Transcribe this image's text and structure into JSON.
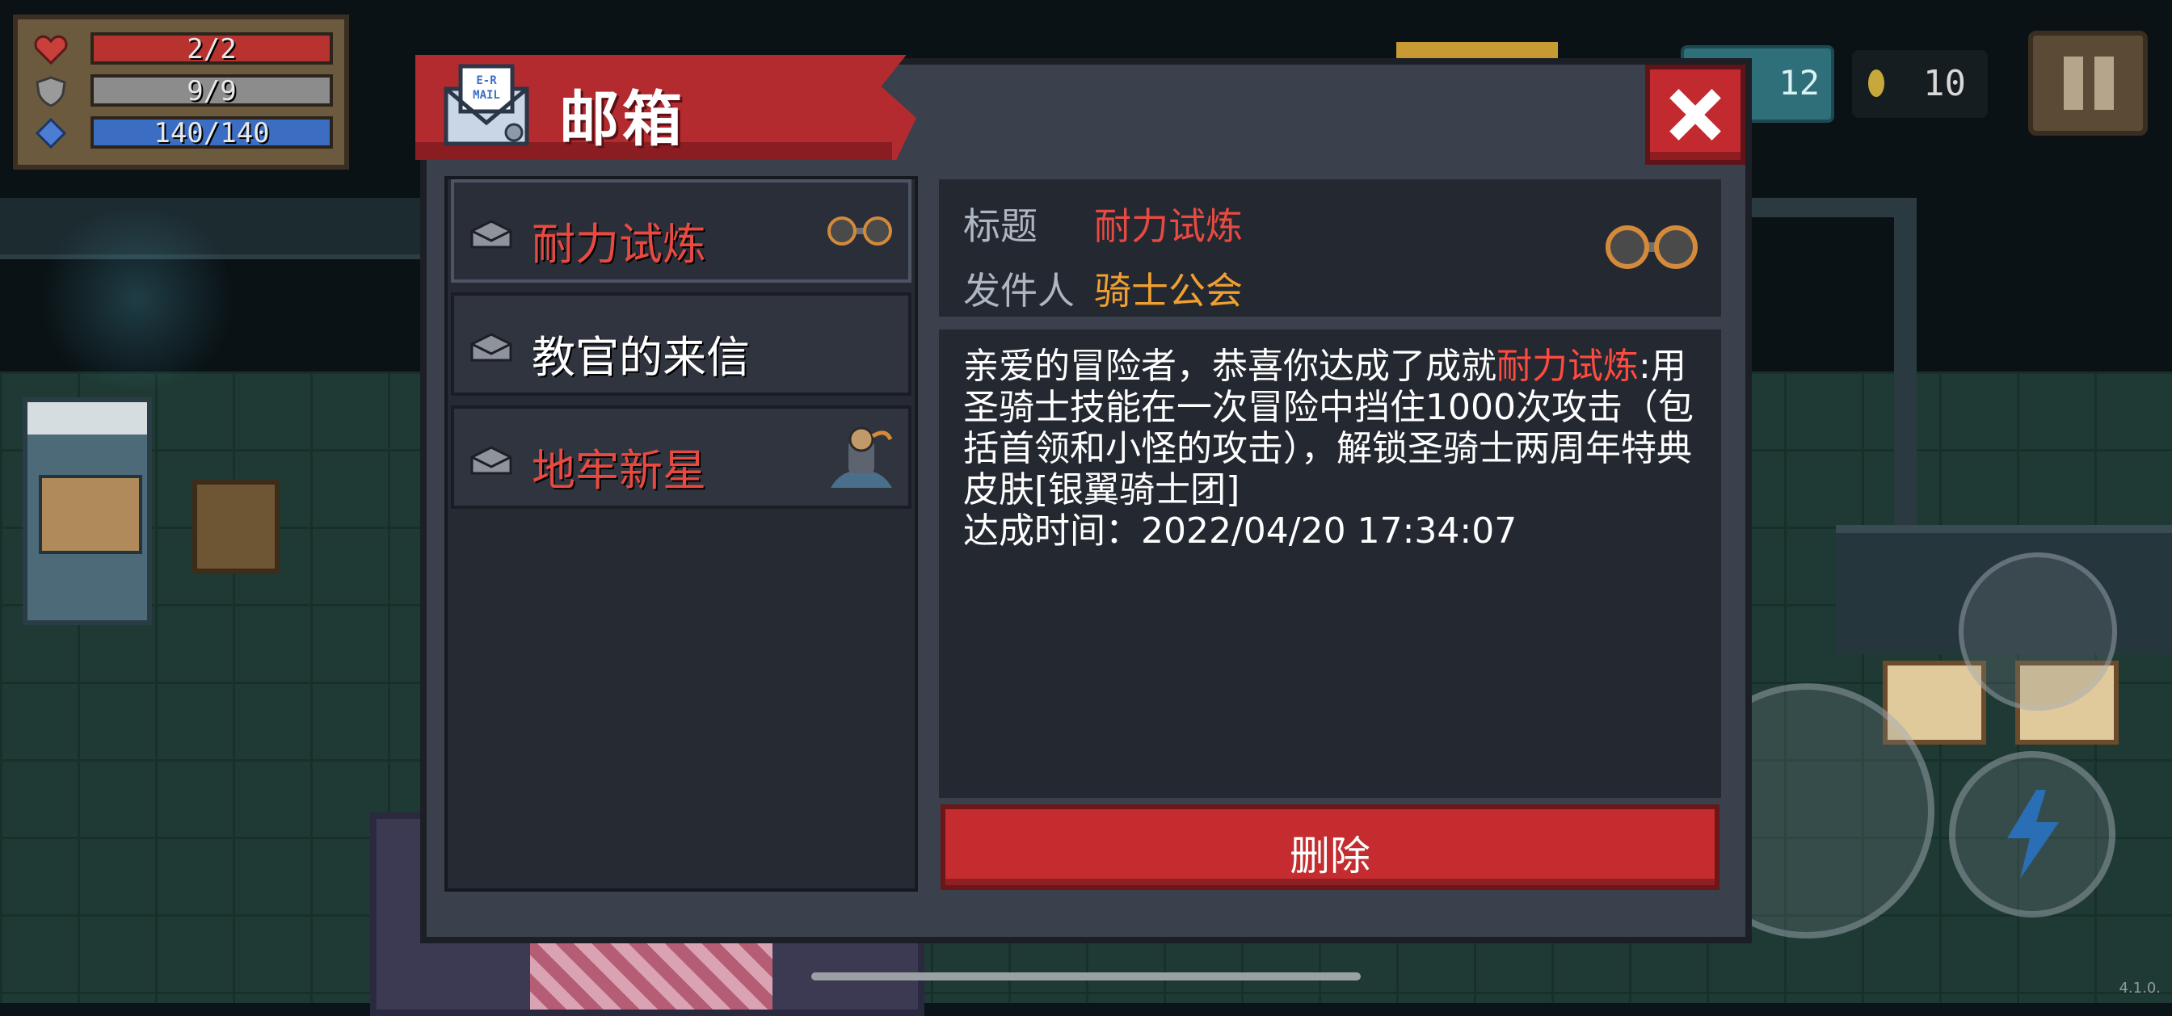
{
  "hud": {
    "health": {
      "text": "2/2",
      "fraction": 1.0,
      "color": "#b8322f"
    },
    "armor": {
      "text": "9/9",
      "fraction": 1.0,
      "color": "#8c8c8c"
    },
    "energy": {
      "text": "140/140",
      "fraction": 1.0,
      "color": "#3b6ec2"
    },
    "gems": "12",
    "coins": "10",
    "version": "4.1.0."
  },
  "mailbox": {
    "title": "邮箱",
    "list": [
      {
        "label": "耐力试炼",
        "style": "red",
        "attachment": "dumbbell-icon",
        "selected": true
      },
      {
        "label": "教官的来信",
        "style": "white",
        "attachment": null,
        "selected": false
      },
      {
        "label": "地牢新星",
        "style": "red",
        "attachment": "character-icon",
        "selected": false
      }
    ],
    "detail": {
      "title_key": "标题",
      "title_value": "耐力试炼",
      "sender_key": "发件人",
      "sender_value": "骑士公会",
      "body_prefix": "亲爱的冒险者，恭喜你达成了成就",
      "body_highlight": "耐力试炼",
      "body_rest": ":用圣骑士技能在一次冒险中挡住1000次攻击（包括首领和小怪的攻击），解锁圣骑士两周年特典皮肤[银翼骑士团]",
      "time_label": "达成时间：",
      "time_value": "2022/04/20 17:34:07"
    },
    "delete_label": "删除"
  },
  "colors": {
    "accent_red": "#c42c2f",
    "highlight_red": "#ff4a40",
    "sender_orange": "#f0a030",
    "panel": "#3a404c"
  }
}
